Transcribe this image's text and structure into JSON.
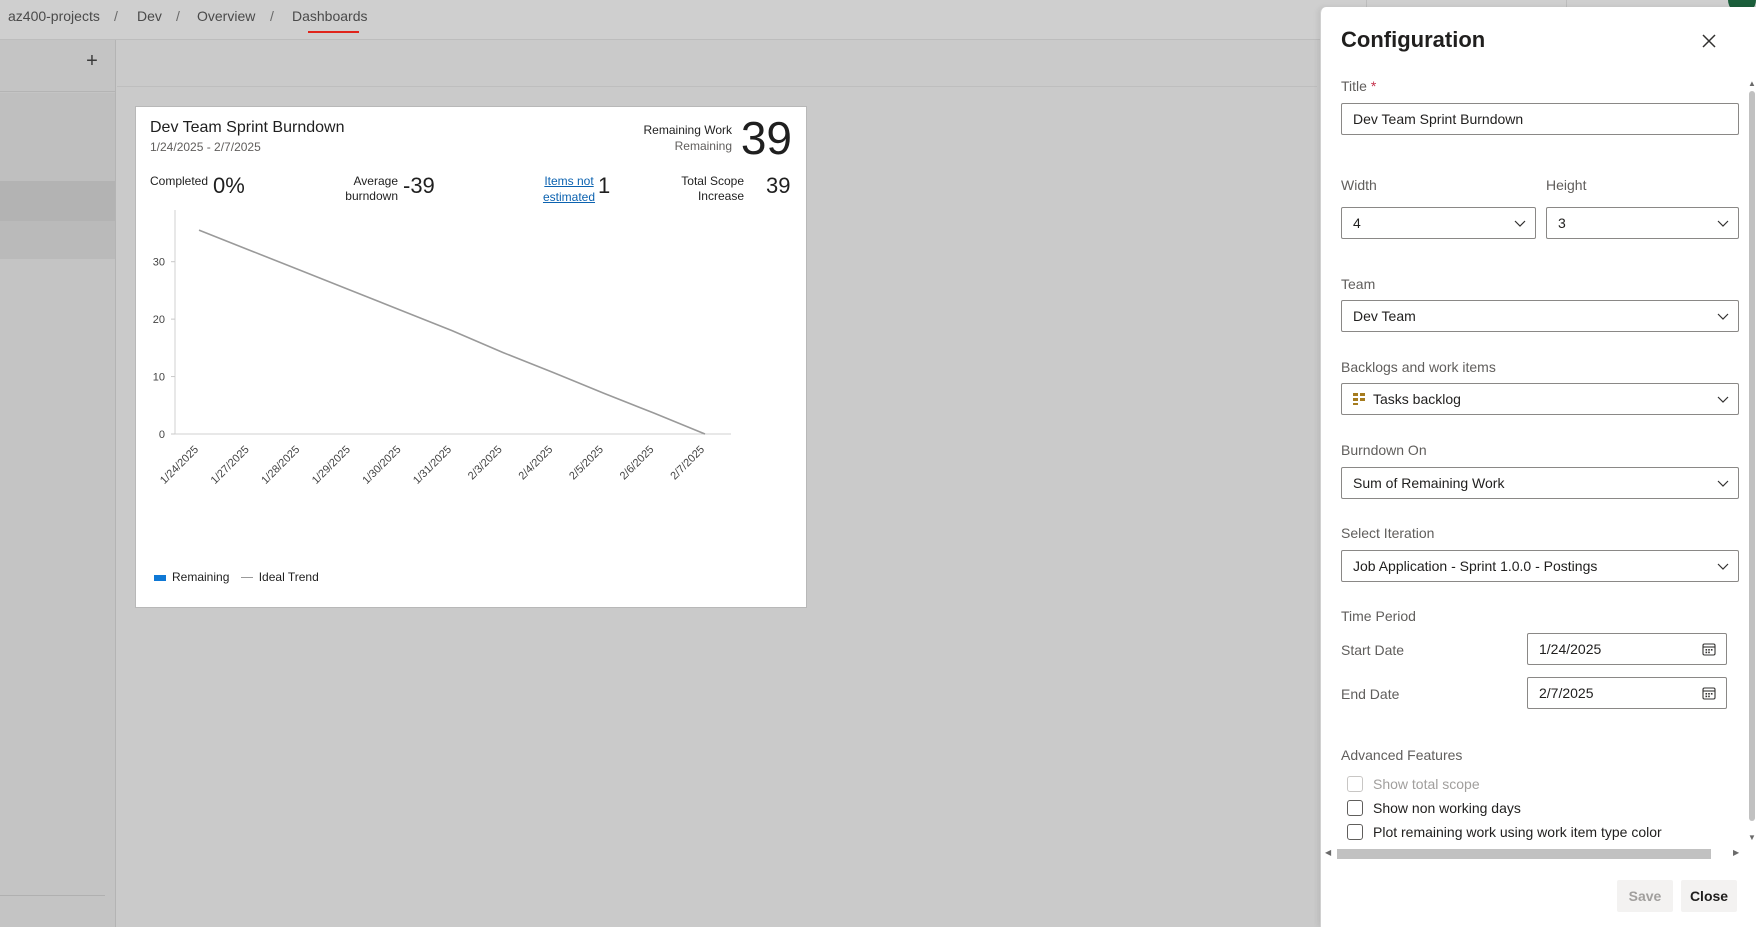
{
  "breadcrumb": {
    "items": [
      "az400-projects",
      "Dev",
      "Overview",
      "Dashboards"
    ],
    "separator": "/"
  },
  "rail": {
    "add_icon": "+",
    "collapse_icon": "«"
  },
  "widget": {
    "title": "Dev Team Sprint Burndown",
    "dates": "1/24/2025 - 2/7/2025",
    "remaining_work_label": "Remaining Work",
    "remaining_label": "Remaining",
    "remaining_value": "39",
    "completed_label": "Completed",
    "completed_value": "0%",
    "avg_burndown_label_1": "Average",
    "avg_burndown_label_2": "burndown",
    "avg_burndown_value": "-39",
    "items_not_estimated_1": "Items not",
    "items_not_estimated_2": "estimated",
    "items_not_estimated_value": "1",
    "total_scope_label_1": "Total Scope",
    "total_scope_label_2": "Increase",
    "total_scope_value": "39",
    "legend_remaining": "Remaining",
    "legend_ideal": "Ideal Trend",
    "remaining_color": "#0e78d5",
    "ideal_color": "#9a9a9a"
  },
  "chart_data": {
    "type": "line",
    "title": "",
    "x": [
      "1/24/2025",
      "1/27/2025",
      "1/28/2025",
      "1/29/2025",
      "1/30/2025",
      "1/31/2025",
      "2/3/2025",
      "2/4/2025",
      "2/5/2025",
      "2/6/2025",
      "2/7/2025"
    ],
    "y_ticks": [
      0,
      10,
      20,
      30
    ],
    "ylim": [
      0,
      39
    ],
    "series": [
      {
        "name": "Ideal Trend",
        "values": [
          35.5,
          32,
          28.5,
          25,
          21.5,
          18,
          14.2,
          10.7,
          7.1,
          3.6,
          0
        ]
      }
    ],
    "legend": [
      "Remaining",
      "Ideal Trend"
    ],
    "legend_position": "bottom-left",
    "grid": false
  },
  "panel": {
    "title": "Configuration",
    "title_label": "Title",
    "title_value": "Dev Team Sprint Burndown",
    "width_label": "Width",
    "width_value": "4",
    "height_label": "Height",
    "height_value": "3",
    "team_label": "Team",
    "team_value": "Dev Team",
    "backlogs_label": "Backlogs and work items",
    "backlogs_value": "Tasks backlog",
    "burndown_on_label": "Burndown On",
    "burndown_on_value": "Sum of Remaining Work",
    "iteration_label": "Select Iteration",
    "iteration_value": "Job Application - Sprint 1.0.0 - Postings",
    "time_period_label": "Time Period",
    "start_date_label": "Start Date",
    "start_date_value": "1/24/2025",
    "end_date_label": "End Date",
    "end_date_value": "2/7/2025",
    "advanced_label": "Advanced Features",
    "opt_total_scope": "Show total scope",
    "opt_non_working": "Show non working days",
    "opt_plot_color": "Plot remaining work using work item type color",
    "save_label": "Save",
    "close_label": "Close"
  }
}
